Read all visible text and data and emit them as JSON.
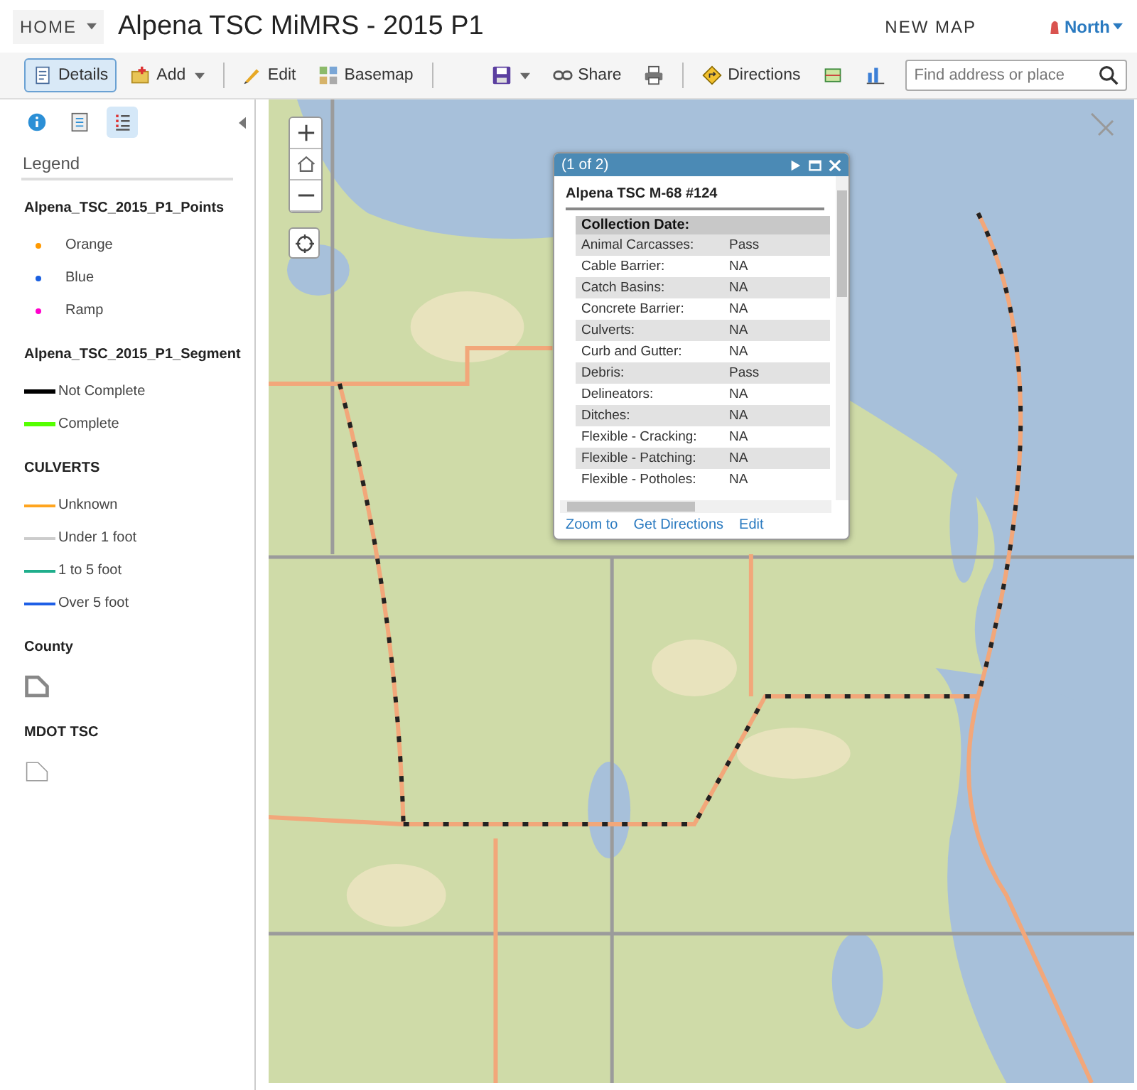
{
  "header": {
    "home": "HOME",
    "title": "Alpena TSC MiMRS - 2015 P1",
    "new_map": "NEW MAP",
    "user": "North"
  },
  "toolbar": [
    {
      "kind": "details",
      "label": "Details",
      "selected": true,
      "dropdown": false
    },
    {
      "kind": "add",
      "label": "Add",
      "selected": false,
      "dropdown": true
    },
    {
      "kind": "separator"
    },
    {
      "kind": "edit",
      "label": "Edit",
      "selected": false,
      "dropdown": false
    },
    {
      "kind": "basemap",
      "label": "Basemap",
      "selected": false,
      "dropdown": false
    },
    {
      "kind": "separator"
    },
    {
      "kind": "spacer"
    },
    {
      "kind": "save",
      "selected": false,
      "dropdown": true
    },
    {
      "kind": "share",
      "label": "Share",
      "selected": false,
      "dropdown": false
    },
    {
      "kind": "print",
      "selected": false,
      "dropdown": false
    },
    {
      "kind": "separator"
    },
    {
      "kind": "directions",
      "label": "Directions",
      "selected": false,
      "dropdown": false
    },
    {
      "kind": "measure",
      "selected": false,
      "dropdown": false
    },
    {
      "kind": "chart",
      "selected": false,
      "dropdown": false
    }
  ],
  "search": {
    "placeholder": "Find address or place"
  },
  "sidebar": {
    "tabs": [
      {
        "kind": "about",
        "selected": false
      },
      {
        "kind": "content",
        "selected": false
      },
      {
        "kind": "legend",
        "selected": true
      }
    ],
    "heading": "Legend",
    "layers": [
      {
        "title": "Alpena_TSC_2015_P1_Points",
        "items": [
          {
            "kind": "point",
            "label": "Orange",
            "color": "#ff9900"
          },
          {
            "kind": "point",
            "label": "Blue",
            "color": "#1a5fe0"
          },
          {
            "kind": "point",
            "label": "Ramp",
            "color": "#ff00cc"
          }
        ]
      },
      {
        "title": "Alpena_TSC_2015_P1_Segment",
        "items": [
          {
            "kind": "thick-line",
            "label": "Not Complete",
            "color": "#000000"
          },
          {
            "kind": "thick-line",
            "label": "Complete",
            "color": "#55ff00"
          }
        ]
      },
      {
        "title": "CULVERTS",
        "items": [
          {
            "kind": "line",
            "label": "Unknown",
            "color": "#ffa51f"
          },
          {
            "kind": "line",
            "label": "Under 1 foot",
            "color": "#cccccc"
          },
          {
            "kind": "line",
            "label": "1 to 5 foot",
            "color": "#1fae8c"
          },
          {
            "kind": "line",
            "label": "Over 5 foot",
            "color": "#1e5fe6"
          }
        ]
      },
      {
        "title": "County",
        "items": [
          {
            "kind": "polygon-thick"
          }
        ]
      },
      {
        "title": "MDOT TSC",
        "items": [
          {
            "kind": "polygon"
          }
        ]
      }
    ]
  },
  "popup": {
    "title": "(1 of 2)",
    "heading": "Alpena TSC M-68 #124",
    "section": "Collection Date:",
    "rows": [
      {
        "label": "Animal Carcasses:",
        "value": "Pass"
      },
      {
        "label": "Cable Barrier:",
        "value": "NA"
      },
      {
        "label": "Catch Basins:",
        "value": "NA"
      },
      {
        "label": "Concrete Barrier:",
        "value": "NA"
      },
      {
        "label": "Culverts:",
        "value": "NA"
      },
      {
        "label": "Curb and Gutter:",
        "value": "NA"
      },
      {
        "label": "Debris:",
        "value": "Pass"
      },
      {
        "label": "Delineators:",
        "value": "NA"
      },
      {
        "label": "Ditches:",
        "value": "NA"
      },
      {
        "label": "Flexible - Cracking:",
        "value": "NA"
      },
      {
        "label": "Flexible - Patching:",
        "value": "NA"
      },
      {
        "label": "Flexible - Potholes:",
        "value": "NA"
      }
    ],
    "links": [
      "Zoom to",
      "Get Directions",
      "Edit"
    ]
  }
}
